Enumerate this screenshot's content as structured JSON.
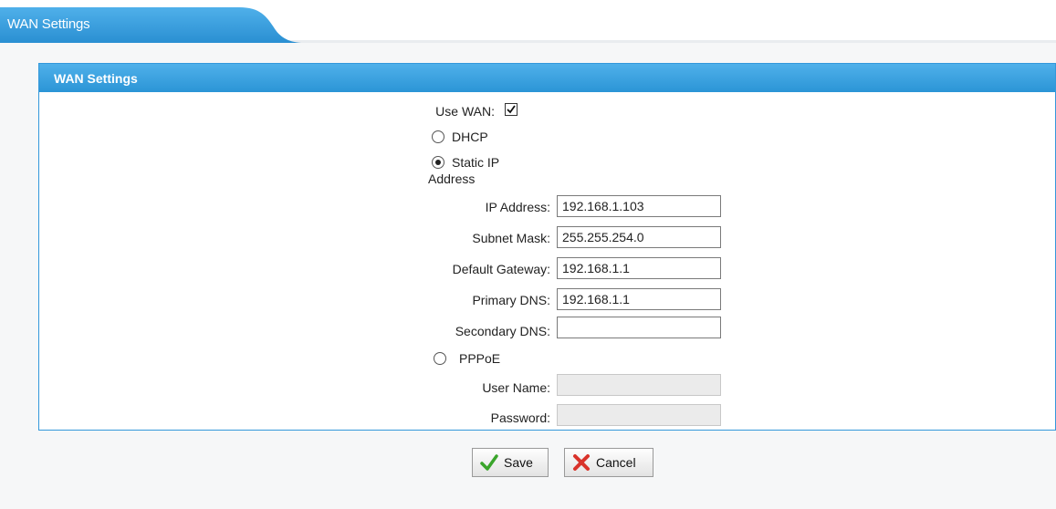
{
  "tab": {
    "title": "WAN Settings"
  },
  "panel": {
    "title": "WAN Settings"
  },
  "form": {
    "use_wan_label": "Use WAN:",
    "use_wan_checked": true,
    "dhcp_label": "DHCP",
    "static_label_line1": "Static IP",
    "static_label_line2": "Address",
    "ip_mode": "static",
    "ip_address_label": "IP Address:",
    "ip_address_value": "192.168.1.103",
    "subnet_mask_label": "Subnet Mask:",
    "subnet_mask_value": "255.255.254.0",
    "default_gateway_label": "Default Gateway:",
    "default_gateway_value": "192.168.1.1",
    "primary_dns_label": "Primary DNS:",
    "primary_dns_value": "192.168.1.1",
    "secondary_dns_label": "Secondary DNS:",
    "secondary_dns_value": "",
    "pppoe_label": "PPPoE",
    "user_name_label": "User Name:",
    "user_name_value": "",
    "password_label": "Password:",
    "password_value": ""
  },
  "actions": {
    "save_label": "Save",
    "cancel_label": "Cancel"
  },
  "colors": {
    "accent": "#2b95d6",
    "save_check": "#3aa52b",
    "cancel_x": "#d9332b"
  },
  "icons": {
    "save": "checkmark-icon",
    "cancel": "x-icon"
  }
}
